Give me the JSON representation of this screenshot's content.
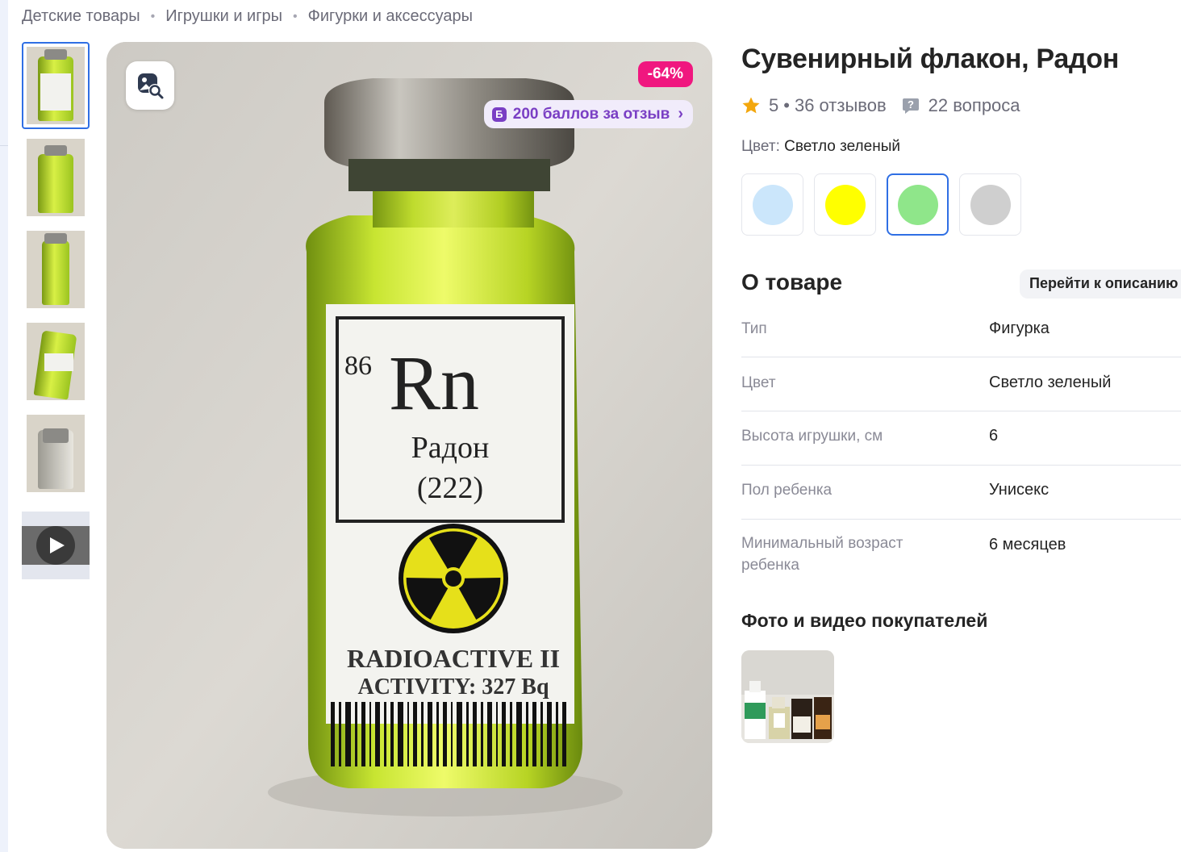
{
  "breadcrumbs": [
    "Детские товары",
    "Игрушки и игры",
    "Фигурки и аксессуары"
  ],
  "gallery": {
    "discount": "-64%",
    "points_badge_letter": "Б",
    "points_text": "200 баллов за отзыв",
    "image_label": {
      "number": "86",
      "symbol": "Rn",
      "name": "Радон",
      "mass": "(222)",
      "radioactive": "RADIOACTIVE II",
      "activity": "ACTIVITY: 327 Bq"
    }
  },
  "product": {
    "title": "Сувенирный флакон, Радон",
    "rating": "5",
    "reviews": "36 отзывов",
    "questions": "22 вопроса",
    "color_label": "Цвет:",
    "color_value": "Светло зеленый",
    "swatches": [
      {
        "color": "#cbe6fb",
        "selected": false
      },
      {
        "color": "#ffff00",
        "selected": false
      },
      {
        "color": "#8fe68a",
        "selected": true
      },
      {
        "color": "#cfcfcf",
        "selected": false
      }
    ]
  },
  "about": {
    "title": "О товаре",
    "goto_description": "Перейти к описанию",
    "specs": [
      {
        "key": "Тип",
        "value": "Фигурка"
      },
      {
        "key": "Цвет",
        "value": "Светло зеленый"
      },
      {
        "key": "Высота игрушки, см",
        "value": "6"
      },
      {
        "key": "Пол ребенка",
        "value": "Унисекс"
      },
      {
        "key": "Минимальный возраст ребенка",
        "value": "6 месяцев"
      }
    ]
  },
  "buyers": {
    "title": "Фото и видео покупателей"
  },
  "colors": {
    "accent_blue": "#2f6fe4",
    "discount_pink": "#f0177f",
    "points_purple": "#7a3fc4",
    "star": "#f3a70d"
  }
}
